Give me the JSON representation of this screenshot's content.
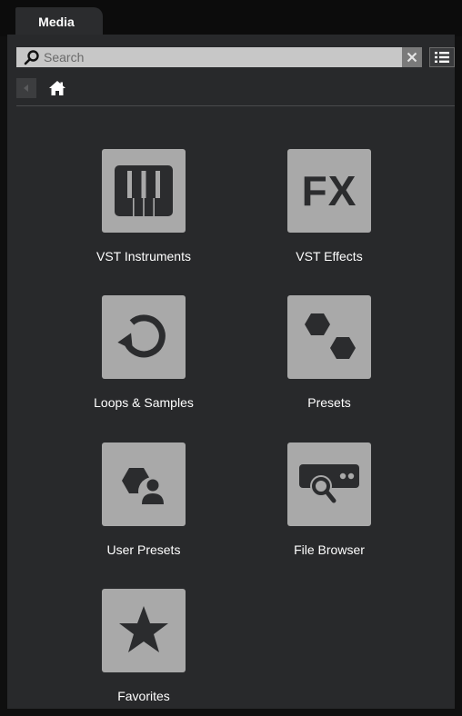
{
  "tabs": [
    {
      "label": "Media"
    }
  ],
  "search": {
    "placeholder": "Search",
    "value": ""
  },
  "toolbar": {
    "clear_icon": "close-icon",
    "view_icon": "list-view-icon",
    "back_icon": "back-icon",
    "home_icon": "home-icon"
  },
  "tiles": [
    {
      "label": "VST Instruments",
      "icon": "piano-keys-icon"
    },
    {
      "label": "VST Effects",
      "icon": "fx-icon",
      "icon_text": "FX"
    },
    {
      "label": "Loops & Samples",
      "icon": "loop-icon"
    },
    {
      "label": "Presets",
      "icon": "presets-icon"
    },
    {
      "label": "User Presets",
      "icon": "user-presets-icon"
    },
    {
      "label": "File Browser",
      "icon": "file-browser-icon"
    },
    {
      "label": "Favorites",
      "icon": "star-icon"
    }
  ],
  "colors": {
    "panel": "#28292b",
    "tile": "#a9a9a9",
    "icon_glyph": "#2b2c2e",
    "label": "#ffffff"
  }
}
